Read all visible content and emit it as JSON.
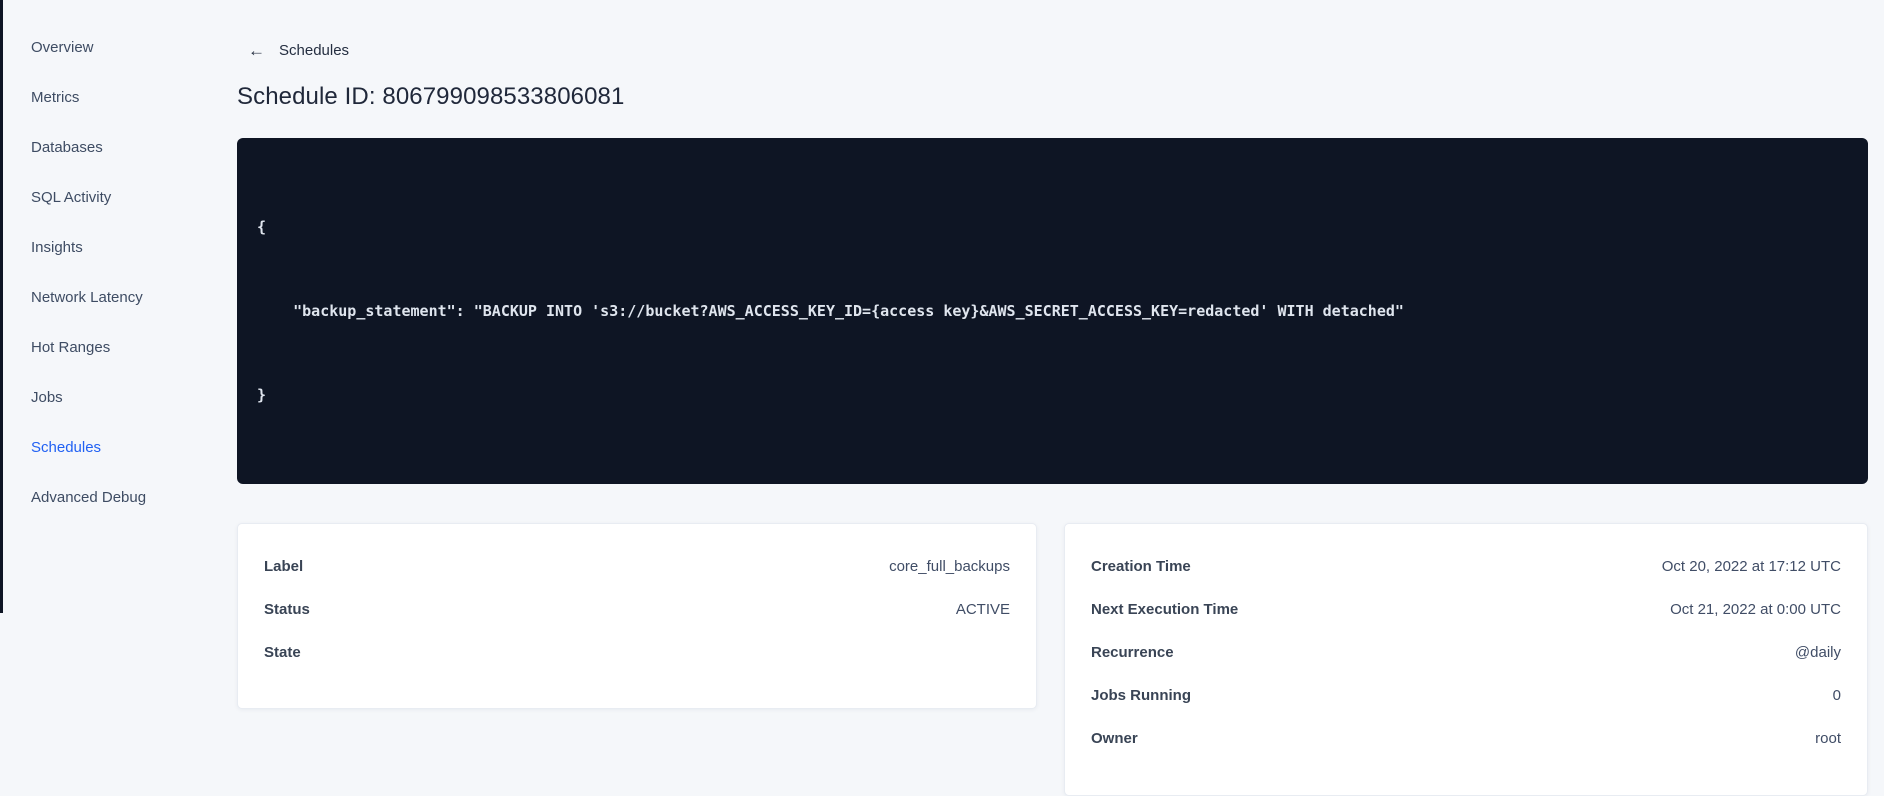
{
  "colors": {
    "accent_blue": "#2161f3",
    "code_block_bg": "#0e1524",
    "page_bg": "#f5f7fa"
  },
  "sidebar": {
    "items": [
      {
        "label": "Overview",
        "active": false
      },
      {
        "label": "Metrics",
        "active": false
      },
      {
        "label": "Databases",
        "active": false
      },
      {
        "label": "SQL Activity",
        "active": false
      },
      {
        "label": "Insights",
        "active": false
      },
      {
        "label": "Network Latency",
        "active": false
      },
      {
        "label": "Hot Ranges",
        "active": false
      },
      {
        "label": "Jobs",
        "active": false
      },
      {
        "label": "Schedules",
        "active": true
      },
      {
        "label": "Advanced Debug",
        "active": false
      }
    ]
  },
  "header": {
    "back_arrow": "←",
    "back_label": "Schedules",
    "title": "Schedule ID: 806799098533806081"
  },
  "code": {
    "lines": [
      "{",
      "    \"backup_statement\": \"BACKUP INTO 's3://bucket?AWS_ACCESS_KEY_ID={access key}&AWS_SECRET_ACCESS_KEY=redacted' WITH detached\"",
      "}"
    ]
  },
  "cards": {
    "schedule": {
      "rows": [
        {
          "label": "Label",
          "value": "core_full_backups"
        },
        {
          "label": "Status",
          "value": "ACTIVE"
        },
        {
          "label": "State",
          "value": ""
        }
      ]
    },
    "execution": {
      "rows": [
        {
          "label": "Creation Time",
          "value": "Oct 20, 2022 at 17:12 UTC"
        },
        {
          "label": "Next Execution Time",
          "value": "Oct 21, 2022 at 0:00 UTC"
        },
        {
          "label": "Recurrence",
          "value": "@daily"
        },
        {
          "label": "Jobs Running",
          "value": "0"
        },
        {
          "label": "Owner",
          "value": "root"
        }
      ]
    }
  }
}
